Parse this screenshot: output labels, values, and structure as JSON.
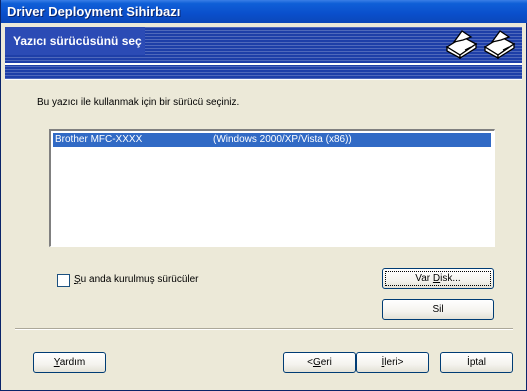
{
  "window": {
    "title": "Driver Deployment Sihirbazı"
  },
  "banner": {
    "title": "Yazıcı sürücüsünü seç",
    "icons": [
      "printer-icon",
      "printer-icon"
    ]
  },
  "instruction": "Bu yazıcı ile kullanmak için bir sürücü seçiniz.",
  "driver_list": {
    "rows": [
      {
        "name": "Brother MFC-XXXX",
        "platform": "(Windows 2000/XP/Vista (x86))",
        "selected": true
      }
    ]
  },
  "checkbox": {
    "label_mnemonic": "Ş",
    "label_rest": "u anda kurulmuş sürücüler",
    "checked": false
  },
  "buttons": {
    "have_disk_prefix": "Var ",
    "have_disk_mnemonic": "D",
    "have_disk_suffix": "isk...",
    "delete": "Sil",
    "help_mnemonic": "Y",
    "help_rest": "ardım",
    "back_prefix": "<",
    "back_mnemonic": "G",
    "back_rest": "eri",
    "next_mnemonic": "İ",
    "next_rest": "leri>",
    "cancel": "İptal"
  }
}
